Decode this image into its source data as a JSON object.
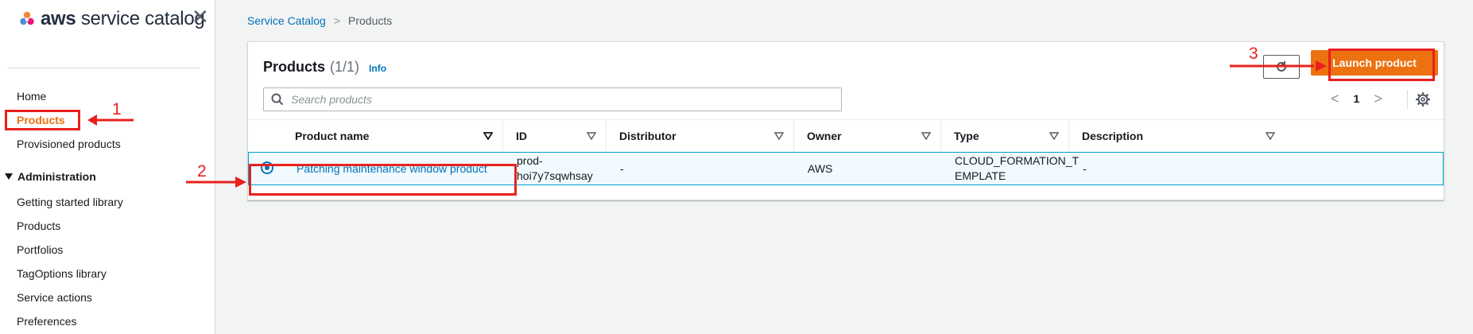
{
  "app": {
    "logo_text_bold": "aws",
    "logo_text": " service catalog",
    "close_glyph": "✕"
  },
  "sidebar": {
    "items": [
      {
        "label": "Home"
      },
      {
        "label": "Products",
        "active": true
      },
      {
        "label": "Provisioned products"
      }
    ],
    "admin_section": {
      "label": "Administration",
      "items": [
        {
          "label": "Getting started library"
        },
        {
          "label": "Products"
        },
        {
          "label": "Portfolios"
        },
        {
          "label": "TagOptions library"
        },
        {
          "label": "Service actions"
        },
        {
          "label": "Preferences"
        }
      ]
    }
  },
  "breadcrumb": {
    "items": [
      {
        "label": "Service Catalog"
      },
      {
        "label": "Products"
      }
    ],
    "separator": ">"
  },
  "products": {
    "title": "Products",
    "count": "(1/1)",
    "info_label": "Info",
    "launch_label": "Launch product",
    "search_placeholder": "Search products",
    "search_value": "",
    "page": "1",
    "prev_glyph": "<",
    "next_glyph": ">",
    "columns": [
      "Product name",
      "ID",
      "Distributor",
      "Owner",
      "Type",
      "Description"
    ],
    "rows": [
      {
        "name": "Patching maintenance window product",
        "id_line1": "prod-",
        "id_line2": "hoi7y7sqwhsay",
        "distributor": "-",
        "owner": "AWS",
        "type_line1": "CLOUD_FORMATION_T",
        "type_line2": "EMPLATE",
        "description": "-",
        "selected": true
      }
    ]
  },
  "annotations": {
    "step1": "1",
    "step2": "2",
    "step3": "3",
    "color": "#e8201e"
  },
  "colors": {
    "accent_orange": "#ec7211",
    "link_blue": "#0073bb",
    "selected_row_bg": "#f1faff",
    "selected_row_border": "#00a1c9"
  }
}
